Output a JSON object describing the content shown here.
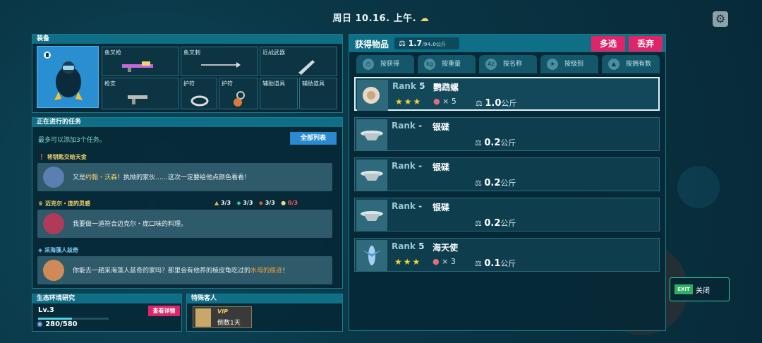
{
  "header": {
    "datetime": "周日 10.16. 上午.",
    "weather_icon": "sun-cloud-icon"
  },
  "equipment": {
    "title": "装备",
    "slots": [
      "鱼叉枪",
      "鱼叉刺",
      "近战武器",
      "枪支",
      "护符",
      "护符",
      "辅助道具",
      "辅助道具"
    ]
  },
  "quests": {
    "title": "正在进行的任务",
    "subtitle": "最多可以添加3个任务。",
    "all_list_button": "全部列表",
    "items": [
      {
        "title": "将钥匙交给天金",
        "text_prefix": "又是",
        "text_highlight": "约翰・沃森",
        "text_suffix": "！执拗的家伙……这次一定要给他点颜色看看！"
      },
      {
        "title": "迈克尔・庞的灵感",
        "text": "我要做一道符合迈克尔・庞口味的料理。",
        "counts": [
          "3/3",
          "3/3",
          "3/3",
          "0/3"
        ]
      },
      {
        "title": "采海藻人兹奇",
        "text_prefix": "你能去一趟采海藻人兹奇的家吗？那里会有他养的棱皮龟吃过的",
        "text_highlight": "水母的痕迹",
        "text_suffix": "！"
      }
    ]
  },
  "eco": {
    "title": "生态环境研究",
    "level": "Lv.3",
    "detail_button": "查看详情",
    "progress": "280/580",
    "progress_fraction": 0.48
  },
  "special": {
    "title": "特殊客人",
    "vip": "VIP",
    "countdown": "倒数1天"
  },
  "loot": {
    "title": "获得物品",
    "weight": "1.7",
    "weight_max": "/94.0公斤",
    "multi_button": "多选",
    "discard_button": "丢弃",
    "tabs": [
      "按获得",
      "按重量",
      "按名称",
      "按级别",
      "按拥有数"
    ],
    "rows": [
      {
        "rank_label": "Rank",
        "rank": "5",
        "name": "鹦鹉螺",
        "stars": "★★★",
        "count": "× 5",
        "weight": "1.0",
        "unit": "公斤"
      },
      {
        "rank_label": "Rank",
        "rank": "-",
        "name": "银碟",
        "stars": "",
        "count": "",
        "weight": "0.2",
        "unit": "公斤"
      },
      {
        "rank_label": "Rank",
        "rank": "-",
        "name": "银碟",
        "stars": "",
        "count": "",
        "weight": "0.2",
        "unit": "公斤"
      },
      {
        "rank_label": "Rank",
        "rank": "-",
        "name": "银碟",
        "stars": "",
        "count": "",
        "weight": "0.2",
        "unit": "公斤"
      },
      {
        "rank_label": "Rank",
        "rank": "5",
        "name": "海天使",
        "stars": "★★★",
        "count": "× 3",
        "weight": "0.1",
        "unit": "公斤"
      }
    ]
  },
  "exit": {
    "badge": "EXIT",
    "label": "关闭"
  }
}
